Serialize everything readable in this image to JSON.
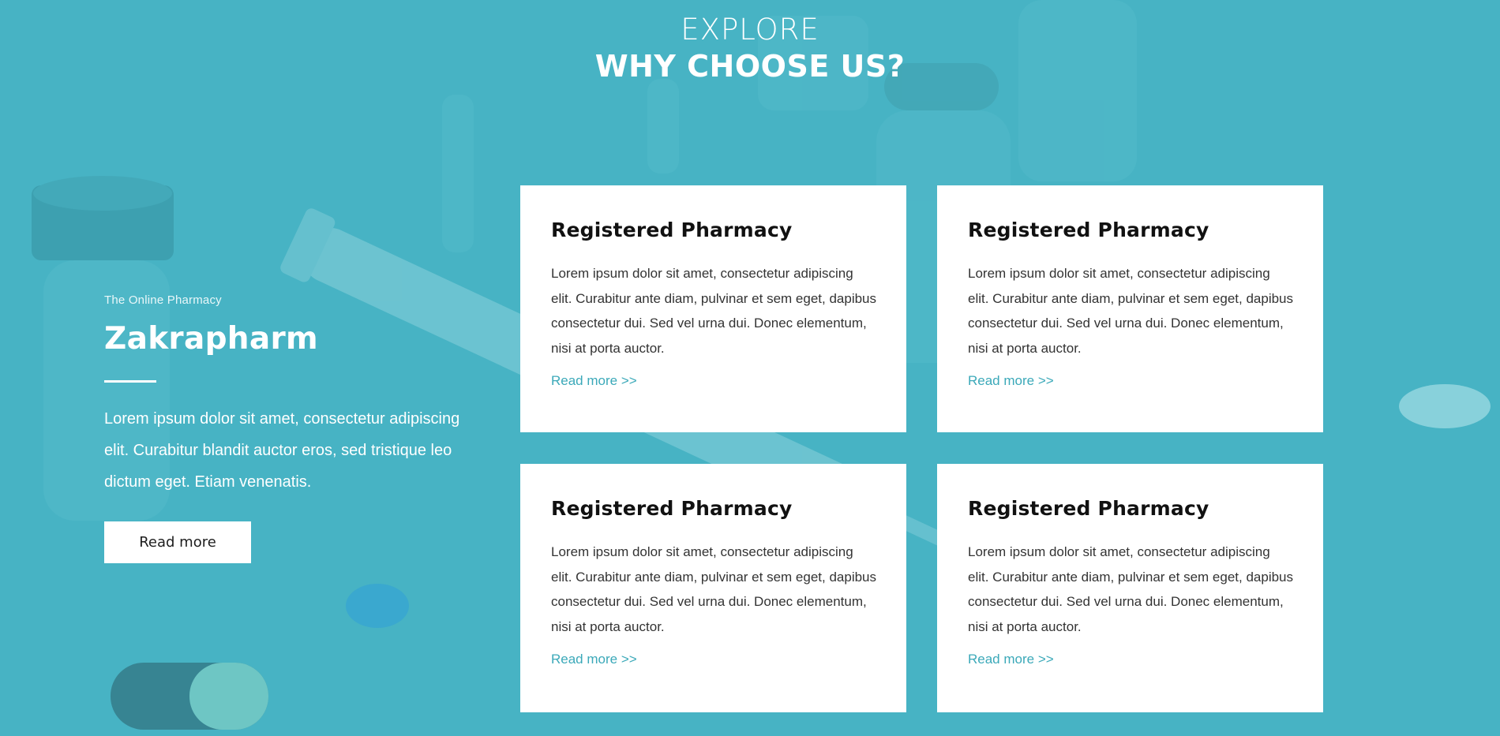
{
  "colors": {
    "background": "#47b3c4",
    "card": "#ffffff",
    "link": "#3ba9b9"
  },
  "header": {
    "eyebrow": "EXPLORE",
    "title": "WHY CHOOSE US?"
  },
  "intro": {
    "tagline": "The Online Pharmacy",
    "brand": "Zakrapharm",
    "blurb": "Lorem ipsum dolor sit amet, consectetur adipiscing elit. Curabitur blandit auctor eros, sed tristique leo dictum eget. Etiam venenatis.",
    "cta_label": "Read more"
  },
  "cards": [
    {
      "title": "Registered Pharmacy",
      "body": "Lorem ipsum dolor sit amet, consectetur adipiscing elit. Curabitur ante diam, pulvinar et sem eget, dapibus consectetur dui. Sed vel urna dui. Donec elementum, nisi at porta auctor.",
      "link": "Read more >>"
    },
    {
      "title": "Registered Pharmacy",
      "body": "Lorem ipsum dolor sit amet, consectetur adipiscing elit. Curabitur ante diam, pulvinar et sem eget, dapibus consectetur dui. Sed vel urna dui. Donec elementum, nisi at porta auctor.",
      "link": "Read more >>"
    },
    {
      "title": "Registered Pharmacy",
      "body": "Lorem ipsum dolor sit amet, consectetur adipiscing elit. Curabitur ante diam, pulvinar et sem eget, dapibus consectetur dui. Sed vel urna dui. Donec elementum, nisi at porta auctor.",
      "link": "Read more >>"
    },
    {
      "title": "Registered Pharmacy",
      "body": "Lorem ipsum dolor sit amet, consectetur adipiscing elit. Curabitur ante diam, pulvinar et sem eget, dapibus consectetur dui. Sed vel urna dui. Donec elementum, nisi at porta auctor.",
      "link": "Read more >>"
    }
  ]
}
